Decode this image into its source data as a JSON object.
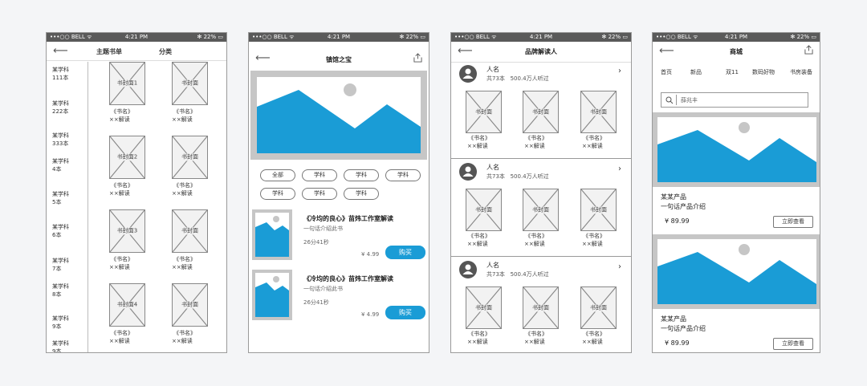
{
  "status": {
    "carrier": "•••○○ BELL ᯤ",
    "time": "4:21 PM",
    "battery": "✻ 22% ▭"
  },
  "colors": {
    "accent": "#1a9cd6",
    "frame": "#c6c6c6"
  },
  "screen1": {
    "title": "主题书单",
    "tab": "分类",
    "subjects": [
      {
        "name": "某学科",
        "count": "111本"
      },
      {
        "name": "某学科",
        "count": "222本"
      },
      {
        "name": "某学科",
        "count": "333本"
      },
      {
        "name": "某学科",
        "count": "4本"
      },
      {
        "name": "某学科",
        "count": "5本"
      },
      {
        "name": "某学科",
        "count": "6本"
      },
      {
        "name": "某学科",
        "count": "7本"
      },
      {
        "name": "某学科",
        "count": "8本"
      },
      {
        "name": "某学科",
        "count": "9本"
      },
      {
        "name": "某学科",
        "count": "9本"
      }
    ],
    "covers": [
      "书封面1",
      "书封面",
      "书封面2",
      "书封面",
      "书封面3",
      "书封面",
      "书封面4",
      "书封面"
    ],
    "book_name": "《书名》",
    "book_read": "××解读"
  },
  "screen2": {
    "title": "镇馆之宝",
    "filters": [
      "全部",
      "学科",
      "学科",
      "学科",
      "学科",
      "学科",
      "学科"
    ],
    "items": [
      {
        "title": "《冷均的良心》苗炜工作室解读",
        "desc": "一句话介绍此书",
        "duration": "26分41秒",
        "price": "¥ 4.99",
        "buy": "购买"
      },
      {
        "title": "《冷均的良心》苗炜工作室解读",
        "desc": "一句话介绍此书",
        "duration": "26分41秒",
        "price": "¥ 4.99",
        "buy": "购买"
      }
    ]
  },
  "screen3": {
    "title": "品牌解读人",
    "people": [
      {
        "name": "人名",
        "stats": "共73本   500.4万人听过"
      },
      {
        "name": "人名",
        "stats": "共73本   500.4万人听过"
      },
      {
        "name": "人名",
        "stats": "共73本   500.4万人听过"
      }
    ],
    "cover": "书封面",
    "book_name": "《书名》",
    "book_read": "××解读"
  },
  "screen4": {
    "title": "商城",
    "tabs": [
      "首页",
      "新品",
      "双11",
      "数码好物",
      "书房装备"
    ],
    "search_placeholder": "薛兆丰",
    "products": [
      {
        "name": "某某产品",
        "desc": "一句话产品介绍",
        "price": "¥ 89.99",
        "button": "立即查看"
      },
      {
        "name": "某某产品",
        "desc": "一句话产品介绍",
        "price": "¥ 89.99",
        "button": "立即查看"
      }
    ]
  }
}
